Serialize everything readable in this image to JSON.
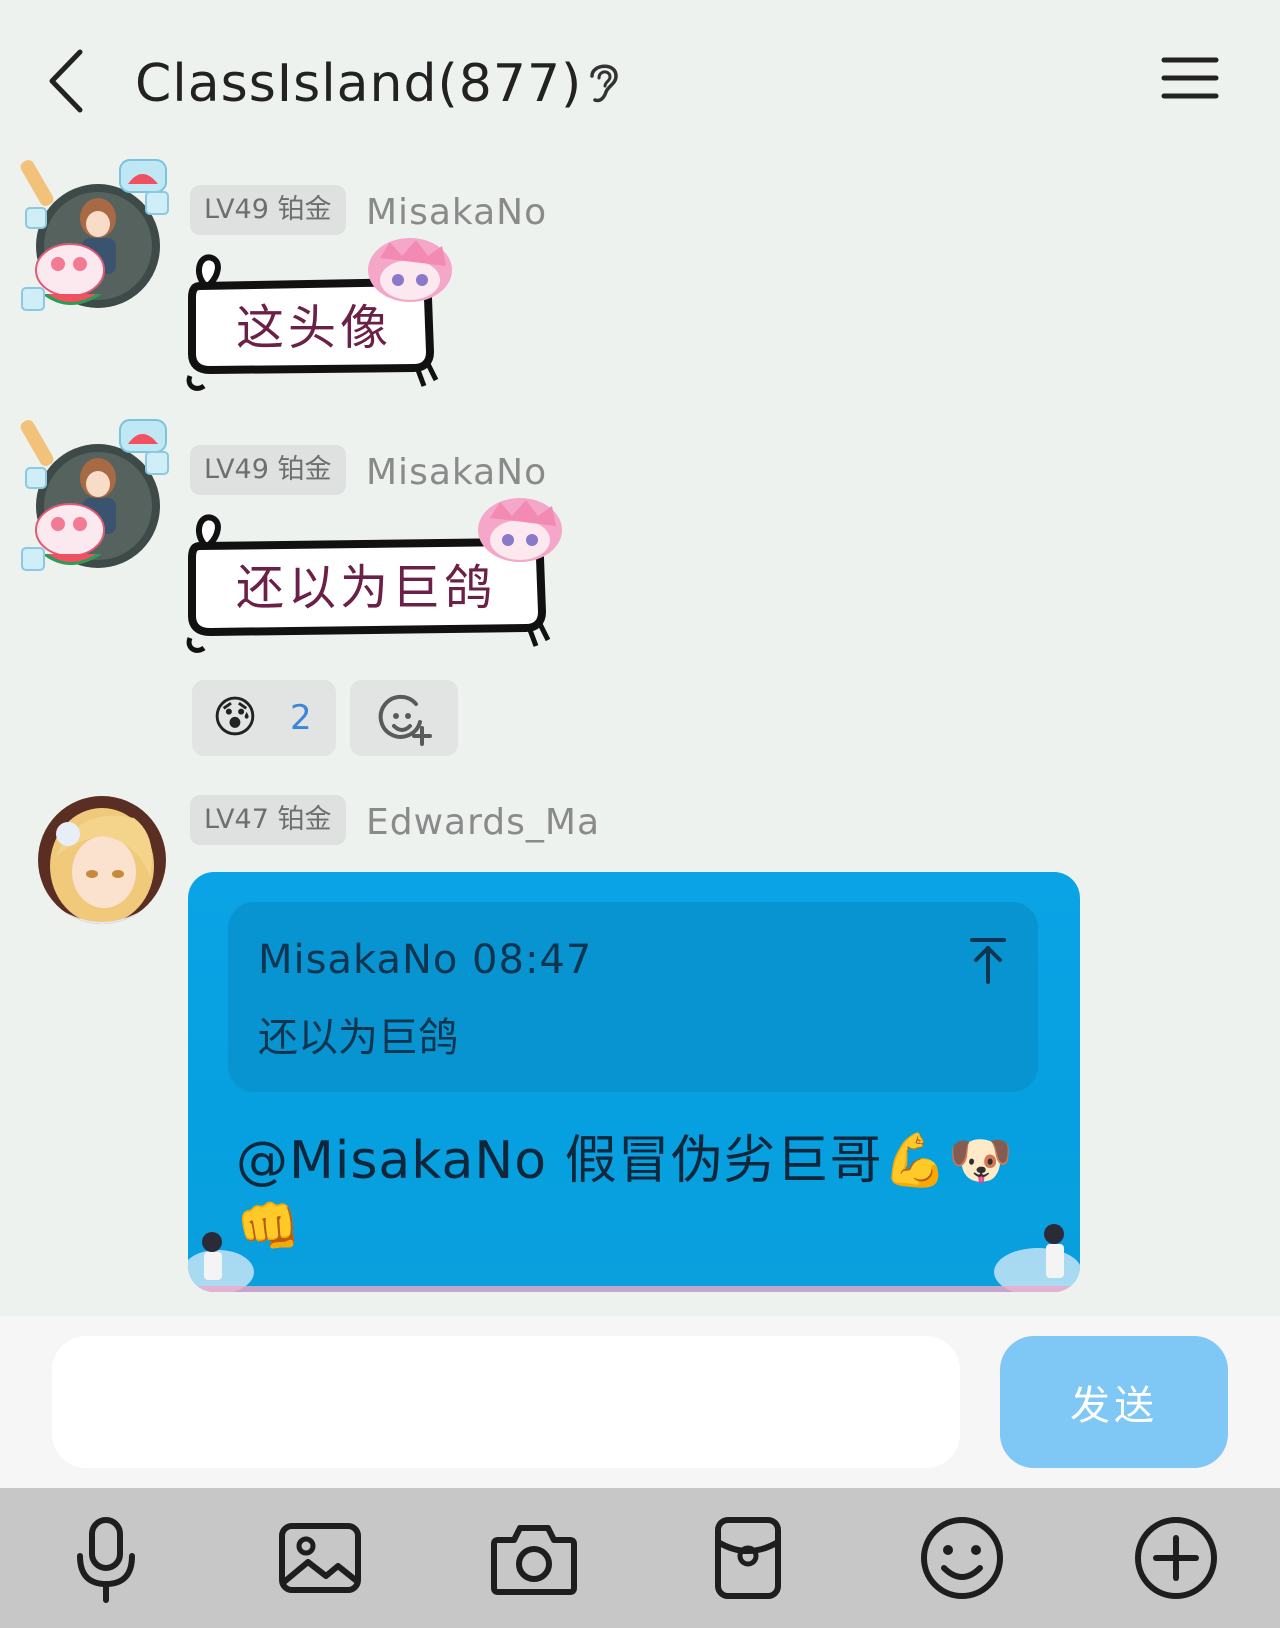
{
  "header": {
    "title": "ClassIsland(877)"
  },
  "messages": [
    {
      "level_badge": "LV49 铂金",
      "sender": "MisakaNo",
      "text": "这头像"
    },
    {
      "level_badge": "LV49 铂金",
      "sender": "MisakaNo",
      "text": "还以为巨鸽",
      "reactions": [
        {
          "emoji": "😰",
          "count": "2"
        }
      ]
    },
    {
      "level_badge": "LV47 铂金",
      "sender": "Edwards_Ma",
      "quote": {
        "meta": "MisakaNo 08:47",
        "text": "还以为巨鸽"
      },
      "text": "@MisakaNo 假冒伪劣巨哥💪🐶👊"
    }
  ],
  "composer": {
    "input_value": "",
    "send_label": "发送"
  },
  "toolbar": {
    "icons": [
      "microphone-icon",
      "image-icon",
      "camera-icon",
      "red-packet-icon",
      "emoji-icon",
      "plus-icon"
    ]
  },
  "colors": {
    "background": "#eef2ef",
    "bubble_blue": "#0aa4e6",
    "send_button": "#7fc7f5",
    "reaction_count": "#3a86d8"
  }
}
